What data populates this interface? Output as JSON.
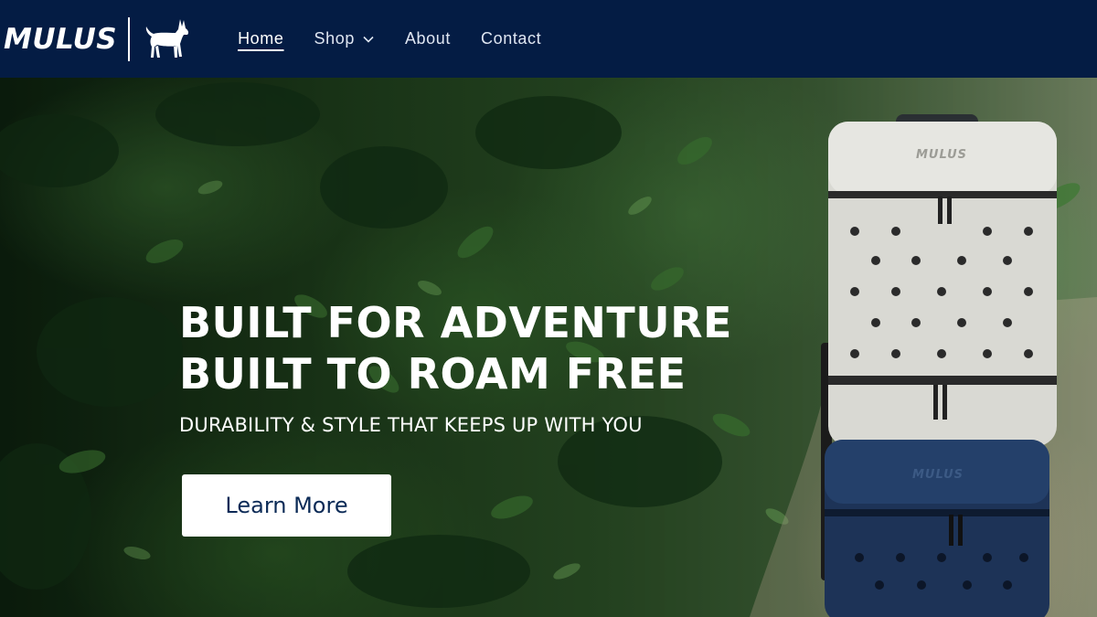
{
  "brand": {
    "name": "MULUS",
    "logo_icon": "donkey-icon"
  },
  "nav": {
    "items": [
      {
        "label": "Home",
        "active": true
      },
      {
        "label": "Shop",
        "has_dropdown": true
      },
      {
        "label": "About"
      },
      {
        "label": "Contact"
      }
    ]
  },
  "hero": {
    "headline_line1": "BUILT FOR ADVENTURE",
    "headline_line2": "BUILT TO ROAM FREE",
    "subheadline": "DURABILITY & STYLE THAT KEEPS UP WITH YOU",
    "cta_label": "Learn More"
  },
  "product": {
    "brand_mark_top": "MULUS",
    "brand_mark_bottom": "MULUS"
  },
  "colors": {
    "header_bg": "#041c44",
    "cta_text": "#0b2a56",
    "pack_light": "#d9d9d3",
    "pack_dark": "#1d3357"
  }
}
